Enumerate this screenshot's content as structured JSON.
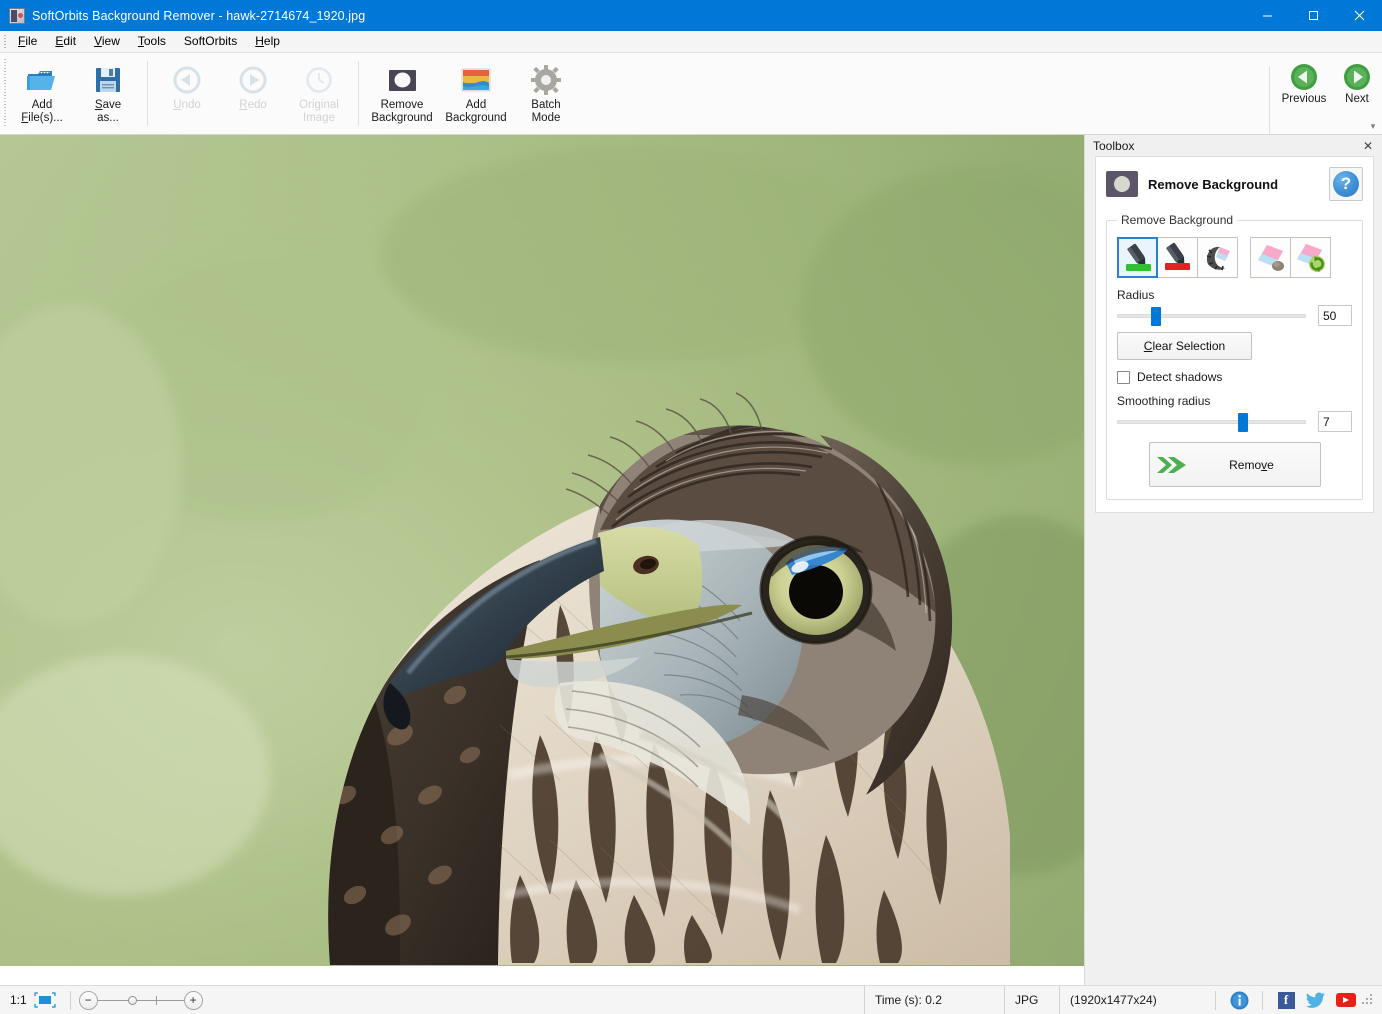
{
  "window": {
    "title": "SoftOrbits Background Remover - hawk-2714674_1920.jpg",
    "app_icon": "app-icon",
    "minimize": "minimize",
    "maximize": "maximize",
    "close": "close",
    "titlebar_color": "#0078d7"
  },
  "menubar": {
    "items": [
      {
        "label": "File",
        "accel": "F"
      },
      {
        "label": "Edit",
        "accel": "E"
      },
      {
        "label": "View",
        "accel": "V"
      },
      {
        "label": "Tools",
        "accel": "T"
      },
      {
        "label": "SoftOrbits",
        "accel": ""
      },
      {
        "label": "Help",
        "accel": "H"
      }
    ]
  },
  "ribbon": {
    "buttons": [
      {
        "line1": "Add",
        "line2": "File(s)...",
        "icon": "folder-add-icon",
        "enabled": true
      },
      {
        "line1": "Save",
        "line2": "as...",
        "icon": "save-icon",
        "enabled": true
      },
      {
        "line1": "Undo",
        "line2": "",
        "icon": "undo-icon",
        "enabled": false
      },
      {
        "line1": "Redo",
        "line2": "",
        "icon": "redo-icon",
        "enabled": false
      },
      {
        "line1": "Original",
        "line2": "Image",
        "icon": "original-image-icon",
        "enabled": false
      },
      {
        "line1": "Remove",
        "line2": "Background",
        "icon": "remove-background-icon",
        "enabled": true
      },
      {
        "line1": "Add",
        "line2": "Background",
        "icon": "add-background-icon",
        "enabled": true
      },
      {
        "line1": "Batch",
        "line2": "Mode",
        "icon": "batch-mode-icon",
        "enabled": true
      }
    ],
    "nav": [
      {
        "label": "Previous",
        "icon": "arrow-left-circle-icon"
      },
      {
        "label": "Next",
        "icon": "arrow-right-circle-icon"
      }
    ],
    "expand": "▾"
  },
  "toolbox": {
    "header": "Toolbox",
    "close_icon": "close-icon",
    "panel_title": "Remove Background",
    "panel_icon": "remove-background-icon",
    "help_label": "?",
    "group_legend": "Remove Background",
    "tools": [
      {
        "name": "mark-foreground-tool",
        "selected": true
      },
      {
        "name": "mark-background-tool",
        "selected": false
      },
      {
        "name": "magic-wand-tool",
        "selected": false
      },
      {
        "name": "eraser-object-tool",
        "selected": false
      },
      {
        "name": "restore-eraser-tool",
        "selected": false
      }
    ],
    "radius": {
      "label": "Radius",
      "value": "50",
      "percent": 18
    },
    "clear_selection": {
      "label": "Clear Selection",
      "accel": "C"
    },
    "detect_shadows": {
      "label": "Detect shadows",
      "checked": false
    },
    "smoothing": {
      "label": "Smoothing radius",
      "value": "7",
      "percent": 64
    },
    "remove": {
      "label": "Remove",
      "accel": "v",
      "icon": "green-double-arrow-icon"
    }
  },
  "canvas": {
    "image_name": "hawk-2714674_1920.jpg",
    "subject": "hawk-photo",
    "background_color": "#a9bd83"
  },
  "statusbar": {
    "zoom_ratio": "1:1",
    "fit_icon": "fit-to-window-icon",
    "zoom_out": "−",
    "zoom_in": "+",
    "time": "Time (s): 0.2",
    "format": "JPG",
    "dimensions": "(1920x1477x24)",
    "icons": [
      {
        "name": "info-icon",
        "glyph": "i"
      },
      {
        "name": "facebook-icon",
        "glyph": "f"
      },
      {
        "name": "twitter-icon",
        "glyph": ""
      },
      {
        "name": "youtube-icon",
        "glyph": ""
      }
    ],
    "resize_grip": "resize-grip"
  }
}
